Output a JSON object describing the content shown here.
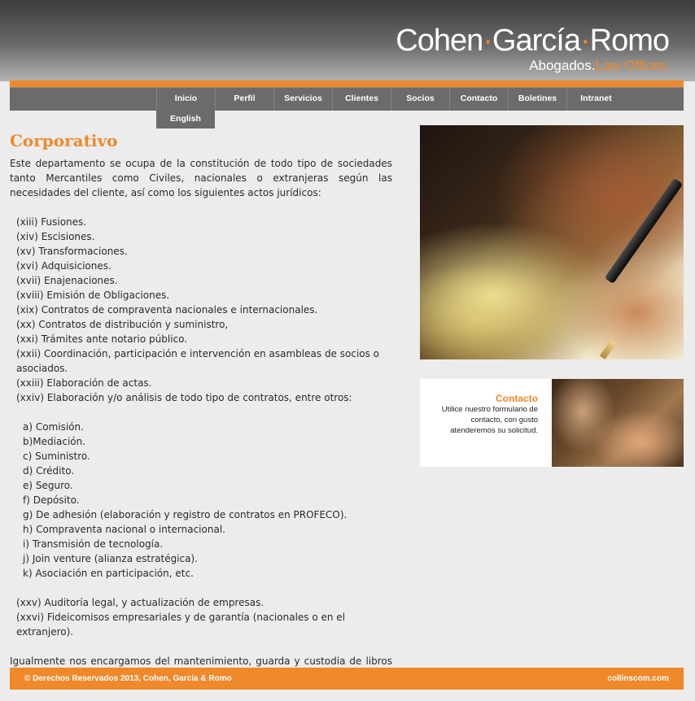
{
  "header": {
    "logo": {
      "part1": "Cohen",
      "dot": "·",
      "part2": "García",
      "part3": "Romo"
    },
    "tagline": {
      "abogados": "Abogados.",
      "law_offices": "Law Offices"
    }
  },
  "nav": {
    "items": [
      {
        "label": "Inicio"
      },
      {
        "label": "Perfil"
      },
      {
        "label": "Servicios"
      },
      {
        "label": "Clientes"
      },
      {
        "label": "Socios"
      },
      {
        "label": "Contacto"
      },
      {
        "label": "Boletines"
      },
      {
        "label": "Intranet"
      }
    ],
    "sub_item": {
      "label": "English"
    }
  },
  "main": {
    "title": "Corporativo",
    "intro": "Este departamento se ocupa de la constitución de todo tipo de sociedades tanto Mercantiles como Civiles, nacionales o extranjeras según las necesidades del cliente, así como los siguientes actos jurídicos:",
    "acts": [
      "(xiii) Fusiones.",
      "(xiv) Escisiones.",
      "(xv) Transformaciones.",
      "(xvi) Adquisiciones.",
      "(xvii) Enajenaciones.",
      "(xviii) Emisión de Obligaciones.",
      "(xix) Contratos de compraventa nacionales e internacionales.",
      "(xx) Contratos de distribución y suministro,",
      "(xxi) Trámites ante notario público.",
      "(xxii) Coordinación, participación e intervención en asambleas de socios o asociados.",
      "(xxiii) Elaboración de actas.",
      "(xxiv) Elaboración y/o análisis de todo tipo de contratos, entre otros:"
    ],
    "contracts": [
      "a) Comisión.",
      "b)Mediación.",
      "c) Suministro.",
      "d) Crédito.",
      "e) Seguro.",
      "f) Depósito.",
      "g) De adhesión (elaboración y registro de contratos en PROFECO).",
      "h) Compraventa nacional o internacional.",
      "i) Transmisión de tecnología.",
      "j) Join venture (alianza estratégica).",
      "k) Asociación en participación, etc."
    ],
    "acts2": [
      "(xxv) Auditoría legal, y actualización de empresas.",
      "(xxvi) Fideicomisos empresariales y de garantía (nacionales o en el extranjero)."
    ],
    "outro": "Igualmente nos encargamos del mantenimiento, guarda y custodia de libros y registros de las sociedades del cliente."
  },
  "contact": {
    "title": "Contacto",
    "text": "Utilice nuestro formulario de contacto, con gusto atenderemos su solicitud."
  },
  "footer": {
    "copyright": "© Derechos Reservados 2013, Cohen, García & Romo",
    "credit": "collinscom.com"
  },
  "colors": {
    "accent": "#f0892a",
    "nav_bg": "#6b6b6b",
    "page_bg": "#ececec"
  }
}
